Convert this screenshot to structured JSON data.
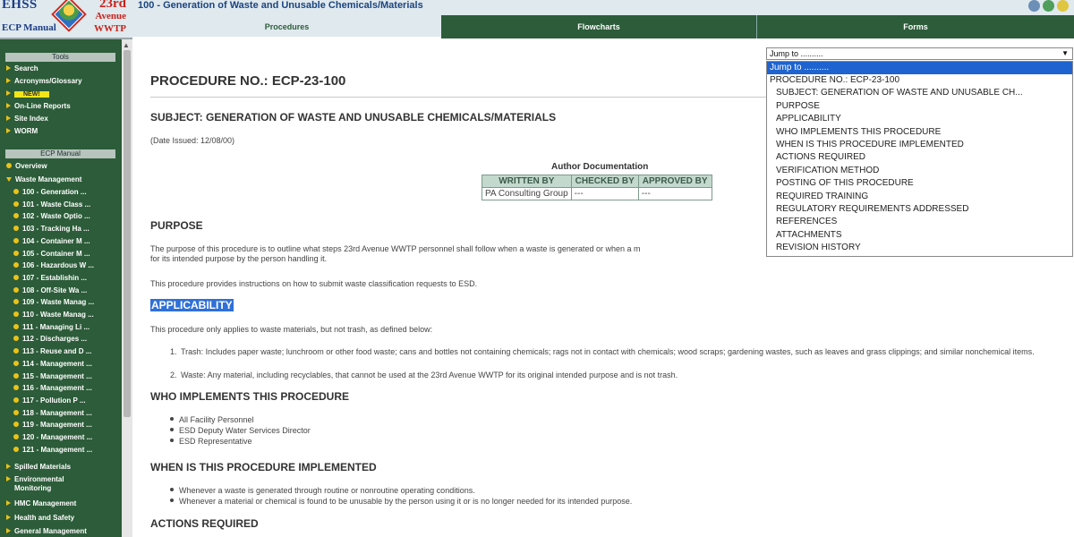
{
  "window": {
    "title": "100 - Generation of Waste and Unusable Chemicals/Materials"
  },
  "logo": {
    "left_text": "EHSS",
    "left_sub": "ECP Manual",
    "right_line1": "23rd",
    "right_line2": "Avenue",
    "right_line3": "WWTP"
  },
  "tabs": [
    "Procedures",
    "Flowcharts",
    "Forms"
  ],
  "nav": {
    "tools_header": "Tools",
    "tools": [
      {
        "label": "Search"
      },
      {
        "label": "Acronyms/Glossary"
      },
      {
        "label": "NEW!"
      },
      {
        "label": "On-Line Reports"
      },
      {
        "label": "Site Index"
      },
      {
        "label": "WORM"
      }
    ],
    "manual_header": "ECP Manual",
    "overview": "Overview",
    "waste_management": "Waste Management",
    "waste_items": [
      "100 - Generation ...",
      "101 - Waste Class ...",
      "102 - Waste Optio ...",
      "103 - Tracking Ha ...",
      "104 - Container M ...",
      "105 - Container M ...",
      "106 - Hazardous W ...",
      "107 - Establishin ...",
      "108 - Off-Site Wa ...",
      "109 - Waste Manag ...",
      "110 - Waste Manag ...",
      "111 - Managing Li ...",
      "112 - Discharges ...",
      "113 - Reuse and D ...",
      "114 - Management ...",
      "115 - Management ...",
      "116 - Management ...",
      "117 - Pollution P ...",
      "118 - Management ...",
      "119 - Management ...",
      "120 - Management ...",
      "121 - Management ..."
    ],
    "sections": [
      "Spilled Materials",
      "Environmental Monitoring",
      "HMC Management",
      "Health and Safety",
      "General Management"
    ]
  },
  "doc": {
    "procedure_no": "PROCEDURE NO.:   ECP-23-100",
    "subject": "SUBJECT:  GENERATION OF WASTE AND UNUSABLE CHEMICALS/MATERIALS",
    "date_issued": "(Date Issued: 12/08/00)",
    "author_doc": {
      "caption": "Author Documentation",
      "headers": [
        "WRITTEN BY",
        "CHECKED BY",
        "APPROVED BY"
      ],
      "row": [
        "PA Consulting Group",
        "---",
        "---"
      ]
    },
    "purpose": {
      "heading": "PURPOSE",
      "p1": "The purpose of this procedure is to outline what steps 23rd Avenue WWTP personnel shall follow when a waste is generated or when a m",
      "p1b": "for its intended purpose by the person handling it.",
      "p2": "This procedure provides instructions on how to submit waste classification requests to ESD."
    },
    "applicability": {
      "heading": "APPLICABILITY",
      "p1": "This procedure only applies to waste materials, but not trash, as defined below:",
      "items": [
        "Trash: Includes paper waste; lunchroom or other food waste; cans and bottles not containing chemicals; rags not in contact with chemicals; wood scraps; gardening wastes, such as leaves and grass clippings; and similar nonchemical items.",
        "Waste: Any material, including recyclables, that cannot be used at the 23rd Avenue WWTP for its original intended purpose and is not trash."
      ]
    },
    "who": {
      "heading": "WHO IMPLEMENTS THIS PROCEDURE",
      "items": [
        "All Facility Personnel",
        "ESD Deputy Water Services Director",
        "ESD Representative"
      ]
    },
    "when": {
      "heading": "WHEN IS THIS PROCEDURE IMPLEMENTED",
      "items": [
        "Whenever a waste is generated through routine or nonroutine operating conditions.",
        "Whenever a material or chemical is found to be unusable by the person using it or is no longer needed for its intended purpose."
      ]
    },
    "actions": {
      "heading": "ACTIONS REQUIRED"
    }
  },
  "jump": {
    "value": "Jump to ..........",
    "options": [
      "Jump to ..........",
      "PROCEDURE NO.:   ECP-23-100",
      "SUBJECT:  GENERATION OF WASTE AND UNUSABLE CH...",
      "PURPOSE",
      "APPLICABILITY",
      "WHO IMPLEMENTS THIS PROCEDURE",
      "WHEN IS THIS PROCEDURE IMPLEMENTED",
      "ACTIONS REQUIRED",
      "VERIFICATION METHOD",
      "POSTING OF THIS PROCEDURE",
      "REQUIRED TRAINING",
      "REGULATORY REQUIREMENTS ADDRESSED",
      "REFERENCES",
      "ATTACHMENTS",
      "REVISION HISTORY"
    ]
  },
  "colors": {
    "nav_bg": "#2c5c39",
    "accent_yellow": "#e9c21a",
    "title_blue": "#1c4480",
    "selection_blue": "#1e63cf"
  }
}
